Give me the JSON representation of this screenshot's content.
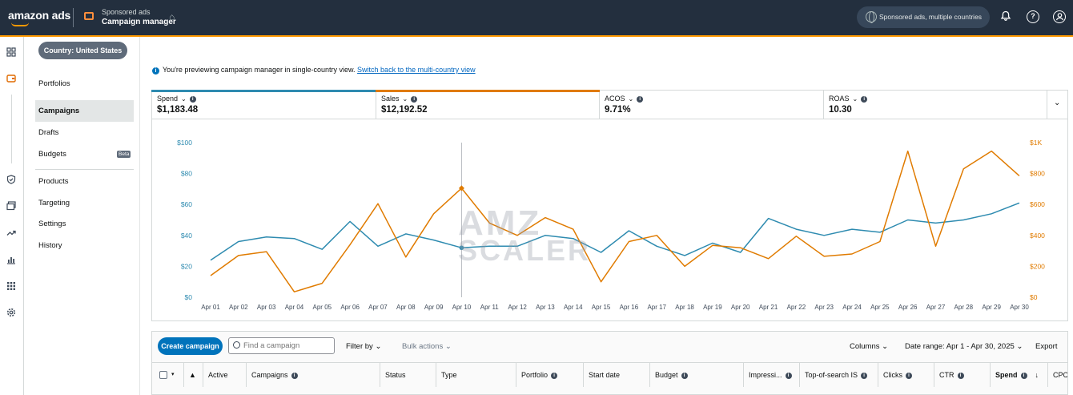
{
  "topbar": {
    "logo": "amazon ads",
    "product_title": "Sponsored ads",
    "product_subtitle": "Campaign manager",
    "account_label": "Sponsored ads, multiple countries"
  },
  "nav": {
    "country": "Country: United States",
    "items": [
      "Portfolios",
      "Campaigns",
      "Drafts",
      "Budgets",
      "Products",
      "Targeting",
      "Settings",
      "History"
    ],
    "beta": "Beta"
  },
  "notice": {
    "text": "You're previewing campaign manager in single-country view.",
    "link": "Switch back to the multi-country view"
  },
  "metrics": [
    {
      "label": "Spend",
      "value": "$1,183.48",
      "color": "#2e8bb0"
    },
    {
      "label": "Sales",
      "value": "$12,192.52",
      "color": "#e07b00"
    },
    {
      "label": "ACOS",
      "value": "9.71%",
      "color": ""
    },
    {
      "label": "ROAS",
      "value": "10.30",
      "color": ""
    }
  ],
  "watermark": {
    "line1": "AMZ",
    "line2": "SCALER"
  },
  "chart_data": {
    "type": "line",
    "x": [
      "Apr 01",
      "Apr 02",
      "Apr 03",
      "Apr 04",
      "Apr 05",
      "Apr 06",
      "Apr 07",
      "Apr 08",
      "Apr 09",
      "Apr 10",
      "Apr 11",
      "Apr 12",
      "Apr 13",
      "Apr 14",
      "Apr 15",
      "Apr 16",
      "Apr 17",
      "Apr 18",
      "Apr 19",
      "Apr 20",
      "Apr 21",
      "Apr 22",
      "Apr 23",
      "Apr 24",
      "Apr 25",
      "Apr 26",
      "Apr 27",
      "Apr 28",
      "Apr 29",
      "Apr 30"
    ],
    "left_ticks": [
      "$0",
      "$20",
      "$40",
      "$60",
      "$80",
      "$100"
    ],
    "right_ticks": [
      "$0",
      "$200",
      "$400",
      "$600",
      "$800",
      "$1K"
    ],
    "ylim_left": [
      0,
      100
    ],
    "ylim_right": [
      0,
      1000
    ],
    "series": [
      {
        "name": "Spend",
        "axis": "left",
        "color": "#2e8bb0",
        "values": [
          24,
          36,
          39,
          38,
          31,
          49,
          33,
          41,
          37,
          32,
          33,
          33,
          40,
          38,
          29,
          43,
          33,
          27,
          35,
          29,
          51,
          44,
          40,
          44,
          42,
          50,
          48,
          50,
          54,
          61
        ]
      },
      {
        "name": "Sales",
        "axis": "right",
        "color": "#e07b00",
        "values": [
          140,
          270,
          295,
          35,
          90,
          340,
          605,
          260,
          540,
          705,
          480,
          400,
          515,
          440,
          100,
          360,
          400,
          200,
          335,
          320,
          250,
          395,
          265,
          280,
          360,
          945,
          330,
          830,
          945,
          785
        ]
      }
    ],
    "hover_index": 9,
    "grid": false
  },
  "table": {
    "create_label": "Create campaign",
    "search_placeholder": "Find a campaign",
    "filter_label": "Filter by",
    "bulk_label": "Bulk actions",
    "columns_label": "Columns",
    "date_range_label": "Date range: Apr 1 - Apr 30, 2025",
    "export_label": "Export",
    "headers": [
      "Active",
      "Campaigns",
      "Status",
      "Type",
      "Portfolio",
      "Start date",
      "Budget",
      "Impressi...",
      "Top-of-search IS",
      "Clicks",
      "CTR",
      "Spend",
      "CPC"
    ]
  }
}
